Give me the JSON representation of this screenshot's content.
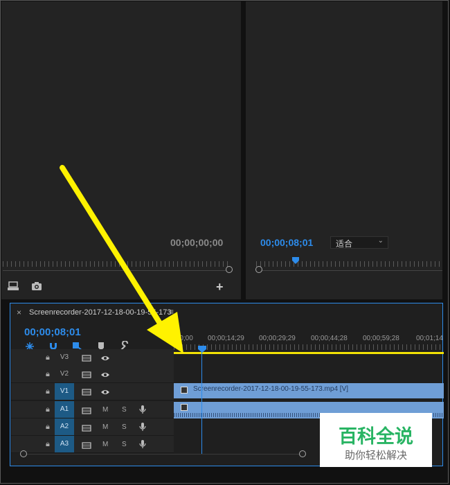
{
  "source_monitor": {
    "timecode": "00;00;00;00"
  },
  "program_monitor": {
    "timecode": "00;00;08;01",
    "zoom": "适合"
  },
  "timeline": {
    "tab_title": "Screenrecorder-2017-12-18-00-19-55-173",
    "close": "×",
    "menu": "≡",
    "timecode": "00;00;08;01",
    "ruler_labels": [
      ";00;00",
      "00;00;14;29",
      "00;00;29;29",
      "00;00;44;28",
      "00;00;59;28",
      "00;01;14"
    ],
    "tracks": {
      "v3": "V3",
      "v2": "V2",
      "v1": "V1",
      "a1": "A1",
      "a2": "A2",
      "a3": "A3",
      "mute": "M",
      "solo": "S"
    },
    "clip_name": "Screenrecorder-2017-12-18-00-19-55-173.mp4 [V]"
  },
  "watermark": {
    "title": "百科全说",
    "subtitle": "助你轻松解决"
  },
  "colors": {
    "accent_blue": "#2d8ceb",
    "arrow": "#fff200",
    "clip": "#6f9ed6"
  },
  "icons": [
    "export-frame-icon",
    "camera-icon",
    "add-icon",
    "lock-icon",
    "film-icon",
    "eye-icon",
    "mic-icon",
    "wrench-icon",
    "marker-icon",
    "magnet-icon",
    "ripple-icon",
    "linked-selection-icon",
    "fx-icon",
    "arrow-annotation"
  ]
}
